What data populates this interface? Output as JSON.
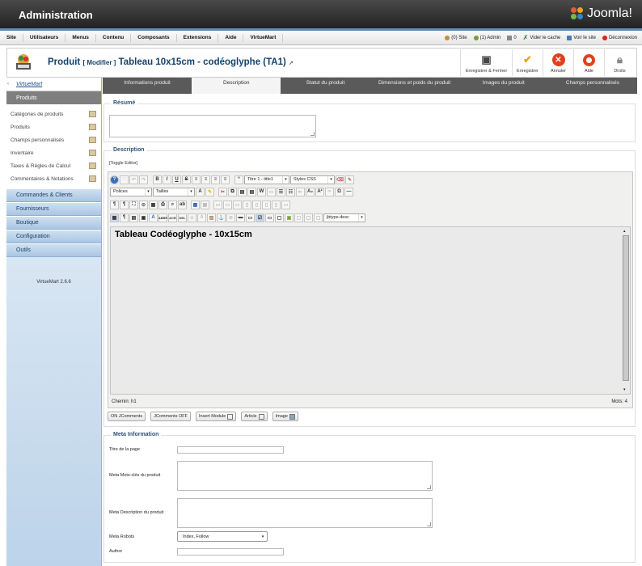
{
  "header": {
    "title": "Administration",
    "brand": "Joomla!"
  },
  "menubar": {
    "items": [
      "Site",
      "Utilisateurs",
      "Menus",
      "Contenu",
      "Composants",
      "Extensions",
      "Aide",
      "VirtueMart"
    ],
    "status": {
      "site": "(0) Site",
      "admin": "(1) Admin",
      "messages": "0",
      "clear_cache": "Vider le cache",
      "view_site": "Voir le site",
      "logout": "Déconnexion"
    }
  },
  "toolbar": {
    "title_prefix": "Produit",
    "title_mode": "[ Modifier ]",
    "title_product": "Tableau 10x15cm - codéoglyphe (TA1)",
    "buttons": {
      "save_close": "Enregistrer & Fermer",
      "save": "Enregistrer",
      "cancel": "Annuler",
      "help": "Aide",
      "rights": "Droits"
    }
  },
  "sidebar": {
    "logo": "VirtueMart",
    "section_active": "Produits",
    "items": [
      "Catégories de produits",
      "Produits",
      "Champs personnalisés",
      "Inventaire",
      "Taxes & Règles de Calcul",
      "Commentaires & Notations"
    ],
    "sections": [
      "Commandes & Clients",
      "Fournisseurs",
      "Boutique",
      "Configuration",
      "Outils"
    ],
    "version": "VirtueMart 2.6.6"
  },
  "tabs": [
    "Informations produit",
    "Description",
    "Statut du produit",
    "Dimensions et poids du produit",
    "Images du produit",
    "Champs personnalisés"
  ],
  "resume": {
    "legend": "Résumé",
    "value": ""
  },
  "description": {
    "legend": "Description",
    "toggle": "[Toggle Editor]",
    "format_select": "Titre 1 - title1",
    "styles_select": "Styles CSS",
    "font_select": "Polices",
    "size_select": "Tailles",
    "class_select": "jbtype.desc",
    "content_heading": "Tableau Codéoglyphe - 10x15cm",
    "path": "Chemin: h1",
    "words": "Mots: 4"
  },
  "plugins": [
    "ON JComments",
    "JComments OFF",
    "Insert Module",
    "Article",
    "Image"
  ],
  "meta": {
    "legend": "Meta Information",
    "page_title_label": "Titre de la page",
    "keywords_label": "Meta Mots-clés du produit",
    "description_label": "Meta Description du produit",
    "robots_label": "Meta Robots",
    "robots_value": "Index, Follow",
    "author_label": "Author"
  },
  "colors": {
    "header_bg": "#2b2b2b",
    "accent": "#5b8bb6",
    "title": "#14426c",
    "sidebar": "#bcd3e9",
    "tabs_bg": "#5a5a5a"
  }
}
